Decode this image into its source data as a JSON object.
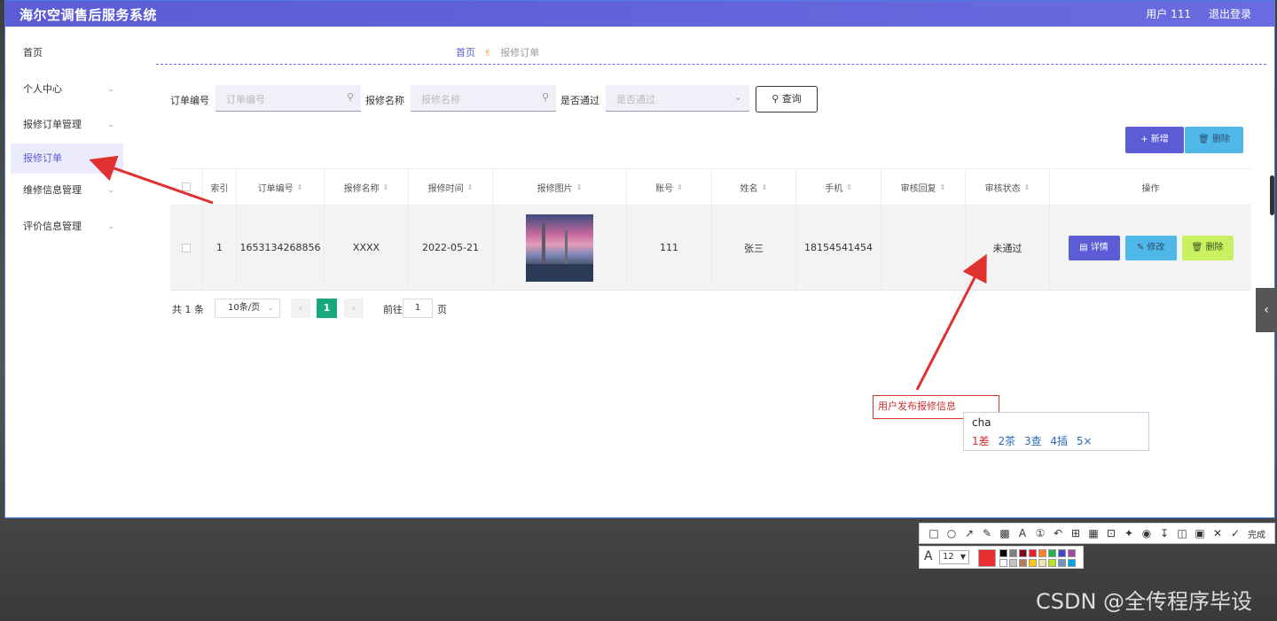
{
  "header": {
    "title": "海尔空调售后服务系统",
    "user": "用户 111",
    "logout": "退出登录"
  },
  "sidebar": {
    "items": [
      {
        "label": "首页",
        "has_chevron": false
      },
      {
        "label": "个人中心",
        "has_chevron": true
      },
      {
        "label": "报修订单管理",
        "has_chevron": true
      },
      {
        "label": "报修订单",
        "has_chevron": false,
        "active": true
      },
      {
        "label": "维修信息管理",
        "has_chevron": true
      },
      {
        "label": "评价信息管理",
        "has_chevron": true
      }
    ]
  },
  "breadcrumb": {
    "home": "首页",
    "current": "报修订单"
  },
  "search": {
    "order_no_label": "订单编号",
    "order_no_placeholder": "订单编号",
    "repair_name_label": "报修名称",
    "repair_name_placeholder": "报修名称",
    "passed_label": "是否通过",
    "passed_placeholder": "是否通过",
    "query_button": "查询"
  },
  "actions": {
    "add": "新增",
    "delete": "删除"
  },
  "table": {
    "columns": [
      "索引",
      "订单编号",
      "报修名称",
      "报修时间",
      "报修图片",
      "账号",
      "姓名",
      "手机",
      "审核回复",
      "审核状态",
      "操作"
    ],
    "rows": [
      {
        "index": "1",
        "order_no": "1653134268856",
        "repair_name": "XXXX",
        "repair_time": "2022-05-21",
        "account": "111",
        "name": "张三",
        "phone": "18154541454",
        "review_reply": "",
        "review_status": "未通过",
        "btn_detail": "详情",
        "btn_edit": "修改",
        "btn_delete": "删除"
      }
    ]
  },
  "pagination": {
    "total": "共 1 条",
    "page_size": "10条/页",
    "current_page": "1",
    "goto_label": "前往",
    "goto_value": "1",
    "page_suffix": "页"
  },
  "annotation": {
    "callout_text": "用户发布报修信息"
  },
  "ime": {
    "typed": "cha",
    "candidates": [
      "1差",
      "2茶",
      "3查",
      "4插",
      "5×"
    ]
  },
  "toolbar": {
    "done": "完成",
    "font_size": "12"
  },
  "colors": {
    "brand": "#5b5cd6",
    "active_bg": "#ecebfb",
    "annotation_red": "#e03030",
    "page_green": "#18a87e"
  },
  "watermark": "CSDN @全传程序毕设"
}
